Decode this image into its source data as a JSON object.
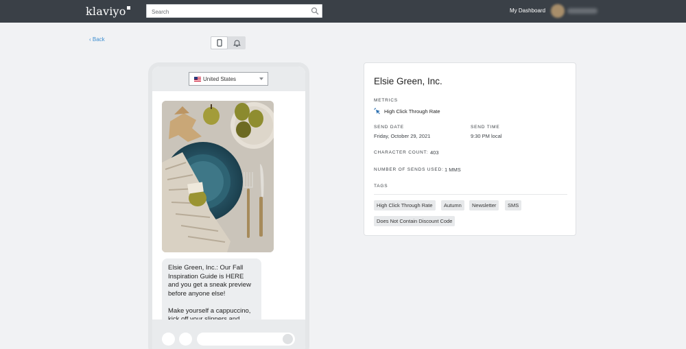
{
  "nav": {
    "logo": "klaviyo",
    "search_placeholder": "Search",
    "dashboard_link": "My Dashboard"
  },
  "back_label": "‹ Back",
  "preview": {
    "country": "United States",
    "message": "Elsie Green, Inc.: Our Fall Inspiration Guide is HERE and you get a sneak preview before anyone else!\n\nMake yourself a cappuccino, kick off your slippers and"
  },
  "details": {
    "title": "Elsie Green, Inc.",
    "metrics_label": "METRICS",
    "metric": "High Click Through Rate",
    "send_date_label": "SEND DATE",
    "send_date": "Friday, October 29, 2021",
    "send_time_label": "SEND TIME",
    "send_time": "9:30 PM local",
    "char_count_label": "CHARACTER COUNT:",
    "char_count": "403",
    "sends_used_label": "NUMBER OF SENDS USED:",
    "sends_used": "1 MMS",
    "tags_label": "TAGS",
    "tags": [
      "High Click Through Rate",
      "Autumn",
      "Newsletter",
      "SMS",
      "Does Not Contain Discount Code"
    ]
  },
  "colors": {
    "topbar": "#3a4047",
    "link": "#3e8ed0",
    "metric_icon": "#2a6fb0"
  },
  "icons": [
    "search-icon",
    "mobile-phone-icon",
    "bell-icon",
    "cursor-click-icon",
    "dropdown-caret-icon"
  ]
}
